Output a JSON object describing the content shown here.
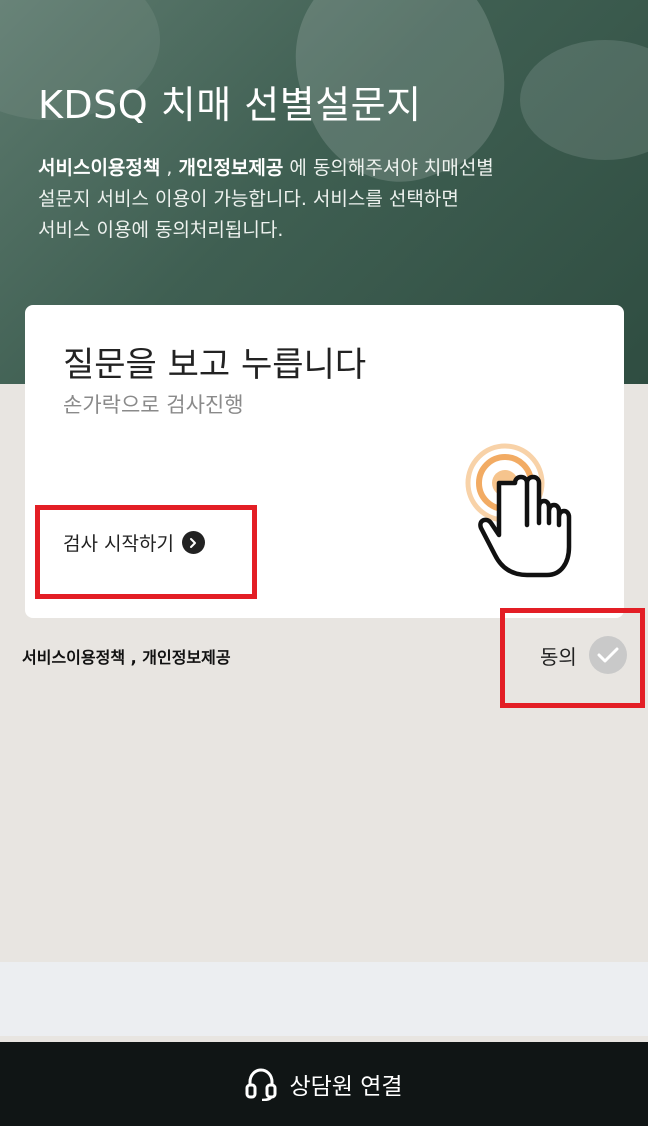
{
  "hero": {
    "title": "KDSQ 치매 선별설문지",
    "desc_link1": "서비스이용정책",
    "desc_sep": " , ",
    "desc_link2": "개인정보제공",
    "desc_line1_rest": " 에 동의해주셔야 치매선별",
    "desc_line2": "설문지 서비스 이용이 가능합니다. 서비스를 선택하면",
    "desc_line3": "서비스 이용에 동의처리됩니다."
  },
  "card": {
    "title": "질문을 보고 누릅니다",
    "subtitle": "손가락으로 검사진행",
    "start_label": "검사 시작하기",
    "start_icon": "chevron-right-icon",
    "illustration_icon": "tap-hand-icon"
  },
  "consent": {
    "text": "서비스이용정책 , 개인정보제공",
    "agree_label": "동의",
    "agree_icon": "check-icon"
  },
  "footer": {
    "label": "상담원 연결",
    "icon": "headset-icon"
  },
  "colors": {
    "hero_green": "#3f5f52",
    "page_bg": "#e8e5e1",
    "highlight_red": "#e31e25",
    "footer_bg": "#101515",
    "hand_ring_orange": "#f0a04b"
  }
}
